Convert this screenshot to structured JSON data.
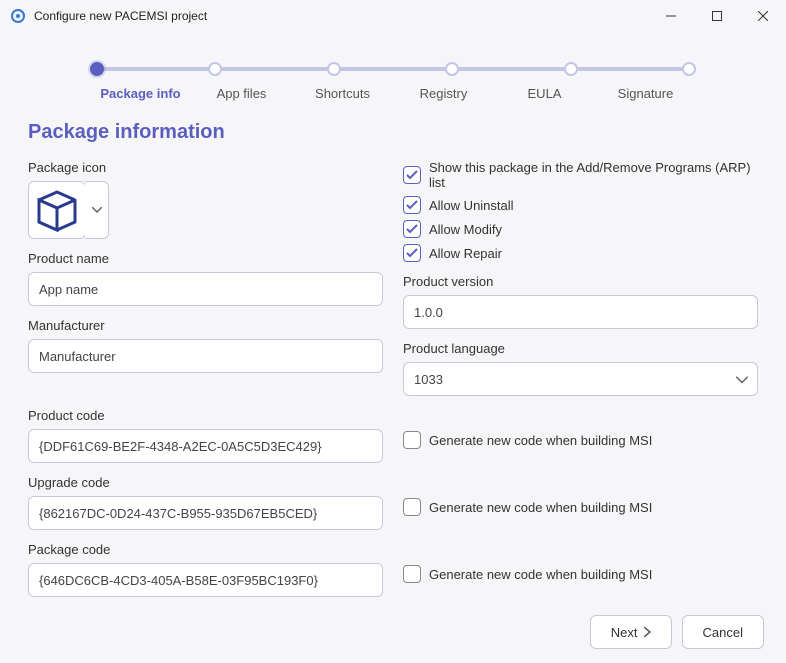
{
  "window": {
    "title": "Configure new PACEMSI project"
  },
  "stepper": {
    "steps": [
      "Package info",
      "App files",
      "Shortcuts",
      "Registry",
      "EULA",
      "Signature"
    ],
    "active_index": 0
  },
  "page": {
    "title": "Package information"
  },
  "labels": {
    "package_icon": "Package icon",
    "product_name": "Product name",
    "manufacturer": "Manufacturer",
    "product_code": "Product code",
    "upgrade_code": "Upgrade code",
    "package_code": "Package code",
    "product_version": "Product version",
    "product_language": "Product language"
  },
  "fields": {
    "product_name": "App name",
    "manufacturer": "Manufacturer",
    "product_code": "{DDF61C69-BE2F-4348-A2EC-0A5C5D3EC429}",
    "upgrade_code": "{862167DC-0D24-437C-B955-935D67EB5CED}",
    "package_code": "{646DC6CB-4CD3-405A-B58E-03F95BC193F0}",
    "product_version": "1.0.0",
    "product_language": "1033"
  },
  "checkboxes": {
    "show_arp": {
      "label": "Show this package in the Add/Remove Programs (ARP) list",
      "checked": true
    },
    "allow_uninstall": {
      "label": "Allow Uninstall",
      "checked": true
    },
    "allow_modify": {
      "label": "Allow Modify",
      "checked": true
    },
    "allow_repair": {
      "label": "Allow Repair",
      "checked": true
    },
    "gen_product_code": {
      "label": "Generate new code when building MSI",
      "checked": false
    },
    "gen_upgrade_code": {
      "label": "Generate new code when building MSI",
      "checked": false
    },
    "gen_package_code": {
      "label": "Generate new code when building MSI",
      "checked": false
    }
  },
  "footer": {
    "next": "Next",
    "cancel": "Cancel"
  }
}
